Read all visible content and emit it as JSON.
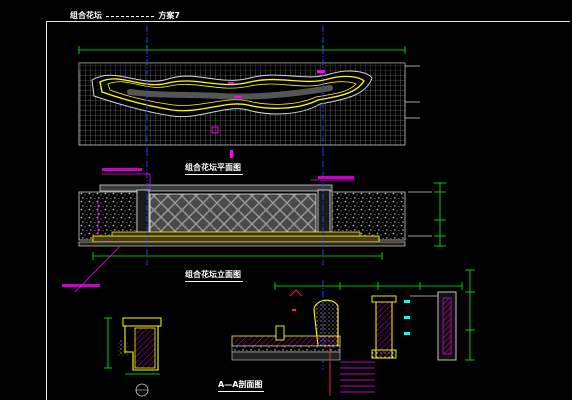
{
  "header": {
    "left": "组合花坛",
    "right": "方案7"
  },
  "captions": {
    "plan": "组合花坛平面图",
    "elevation": "组合花坛立面图",
    "section": "A—A剖面图"
  },
  "colors": {
    "background": "#000000",
    "frame": "#e6e6e6",
    "hatch_white": "#d9d9d9",
    "yellow": "#ffff00",
    "magenta": "#ff00ff",
    "blue_axis": "#2f3cff",
    "green": "#00ff00",
    "red": "#ff3030",
    "cyan": "#00ffff"
  }
}
